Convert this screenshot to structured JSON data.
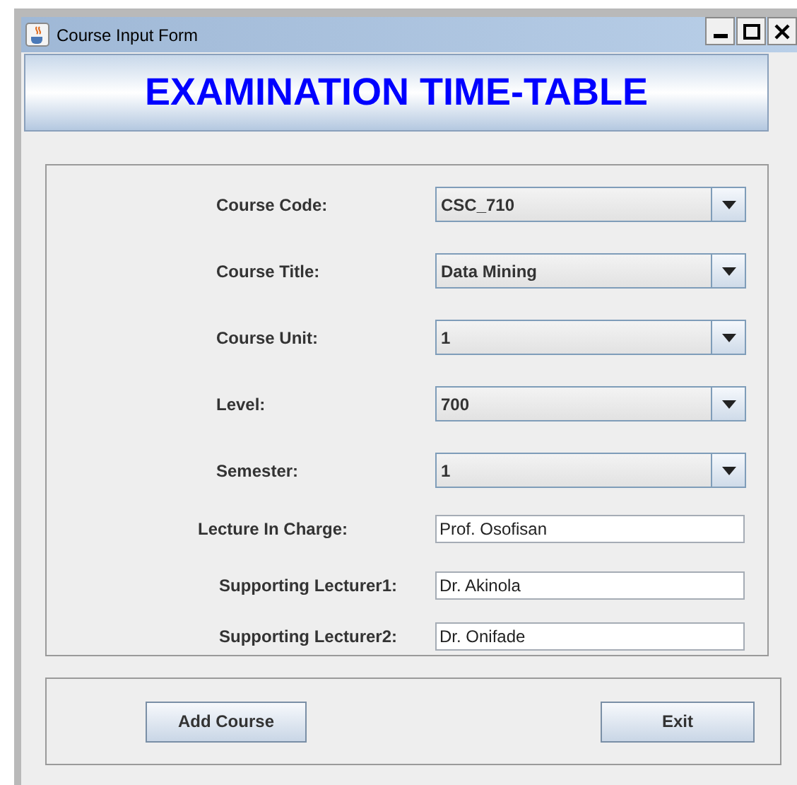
{
  "window": {
    "title": "Course Input Form"
  },
  "header": {
    "title": "EXAMINATION TIME-TABLE"
  },
  "fields": [
    {
      "kind": "dropdown",
      "label": "Course Code:",
      "value": "CSC_710"
    },
    {
      "kind": "dropdown",
      "label": "Course Title:",
      "value": "Data Mining"
    },
    {
      "kind": "dropdown",
      "label": "Course Unit:",
      "value": "1"
    },
    {
      "kind": "dropdown",
      "label": "Level:",
      "value": "700"
    },
    {
      "kind": "dropdown",
      "label": "Semester:",
      "value": "1"
    },
    {
      "kind": "text",
      "label": "Lecture In Charge:",
      "value": "Prof. Osofisan"
    },
    {
      "kind": "text",
      "label": "Supporting Lecturer1:",
      "value": "Dr. Akinola"
    },
    {
      "kind": "text",
      "label": "Supporting Lecturer2:",
      "value": "Dr. Onifade"
    }
  ],
  "buttons": [
    "Add Course",
    "Exit"
  ]
}
